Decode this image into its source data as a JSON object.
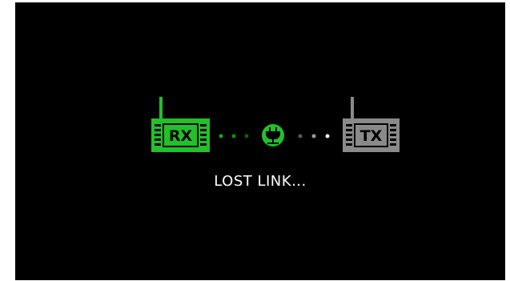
{
  "status": {
    "message": "LOST LINK..."
  },
  "receiver": {
    "label": "RX",
    "icon": "receiver-icon",
    "color": "#22c02a"
  },
  "transmitter": {
    "label": "TX",
    "icon": "transmitter-icon",
    "color": "#8a8a8a"
  },
  "link": {
    "icon": "plug-icon",
    "accent": "#22c02a",
    "dots_left_color": "#1fa326",
    "dots_right_color": "#bfbfbf"
  }
}
